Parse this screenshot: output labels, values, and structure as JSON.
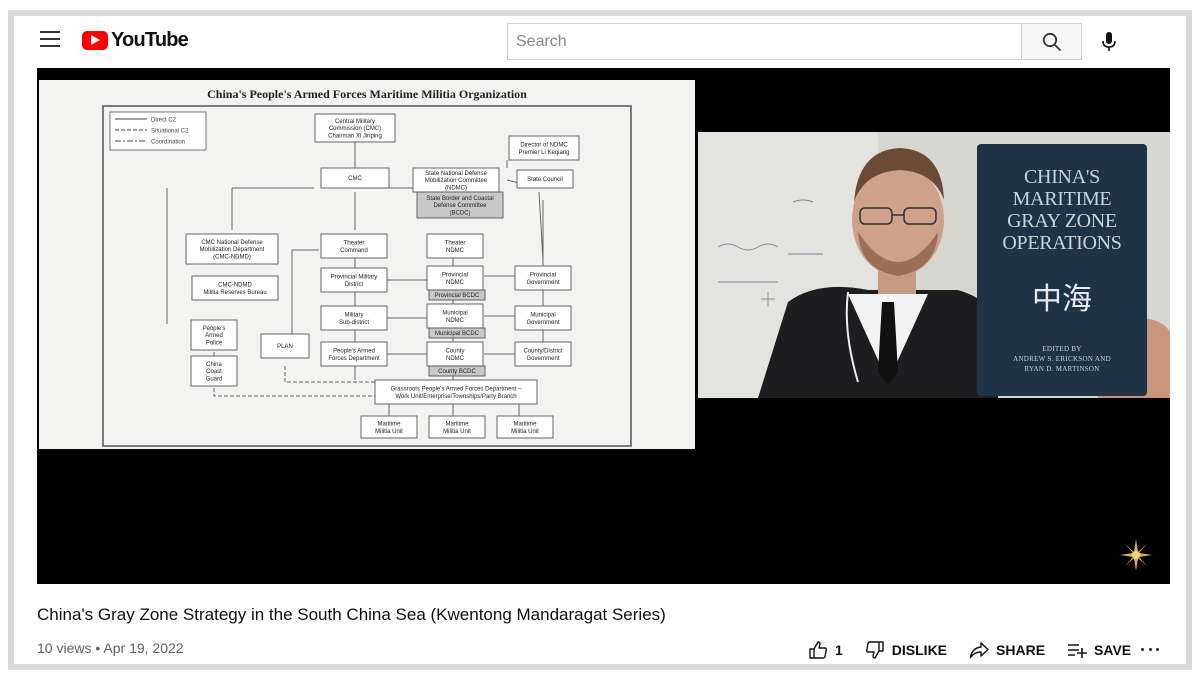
{
  "header": {
    "logo_text": "YouTube",
    "search": {
      "placeholder": "Search",
      "value": ""
    },
    "icons": [
      "menu-icon",
      "youtube-logo",
      "search-icon",
      "mic-icon"
    ]
  },
  "video": {
    "title": "China's Gray Zone Strategy in the South China Sea (Kwentong Mandaragat Series)",
    "views": "10 views",
    "separator": "•",
    "date": "Apr 19, 2022"
  },
  "slide": {
    "title": "China's People's Armed Forces Maritime Militia Organization",
    "legend": [
      "Direct C2",
      "Situational C2",
      "Coordination"
    ],
    "boxes": {
      "cmc_top": [
        "Central Military",
        "Commission (CMC)",
        "Chairman Xi Jinping"
      ],
      "ndmc_director": [
        "Director of NDMC",
        "Premier Li Keqiang"
      ],
      "cmc": [
        "CMC"
      ],
      "sndmc": [
        "State National Defense",
        "Mobilization Committee",
        "(NDMC)"
      ],
      "bcdc": [
        "State Border and Coastal",
        "Defense Committee",
        "(BCDC)"
      ],
      "state_council": [
        "State Council"
      ],
      "ndmd": [
        "CMC National Defense",
        "Mobilization Department",
        "(CMC-NDMD)"
      ],
      "theater_cmd": [
        "Theater",
        "Command"
      ],
      "theater_ndmc": [
        "Theater",
        "NDMC"
      ],
      "militia_bureau": [
        "CMC-NDMD",
        "Militia Reserves Bureau"
      ],
      "prov_district": [
        "Provincial Military",
        "District"
      ],
      "prov_ndmc": [
        "Provincial",
        "NDMC"
      ],
      "prov_gov": [
        "Provincial",
        "Government"
      ],
      "prov_bcdc": [
        "Provincial BCDC"
      ],
      "pap": [
        "People's",
        "Armed",
        "Police"
      ],
      "plan": [
        "PLAN"
      ],
      "mil_sub": [
        "Military",
        "Sub-district"
      ],
      "mun_ndmc": [
        "Municipal",
        "NDMC"
      ],
      "mun_gov": [
        "Municipal",
        "Government"
      ],
      "mun_bcdc": [
        "Municipal BCDC"
      ],
      "ccg": [
        "China",
        "Coast",
        "Guard"
      ],
      "pafd": [
        "People's Armed",
        "Forces Department"
      ],
      "county_ndmc": [
        "County",
        "NDMC"
      ],
      "county_gov": [
        "County/District",
        "Government"
      ],
      "county_bcdc": [
        "County BCDC"
      ],
      "grassroots": [
        "Grassroots People's Armed Forces Department –",
        "Work Unit/Enterprise/Townships/Party Branch"
      ],
      "unit1": [
        "Maritime",
        "Militia Unit"
      ],
      "unit2": [
        "Maritime",
        "Militia Unit"
      ],
      "unit3": [
        "Maritime",
        "Militia Unit"
      ]
    }
  },
  "book": {
    "title_lines": [
      "CHINA'S MARITIME",
      "GRAY ZONE",
      "OPERATIONS"
    ],
    "chinese": "中海",
    "editors": [
      "EDITED BY",
      "ANDREW S. ERICKSON AND",
      "RYAN D. MARTINSON"
    ]
  },
  "actions": {
    "like_count": "1",
    "dislike_label": "DISLIKE",
    "share_label": "SHARE",
    "save_label": "SAVE"
  },
  "colors": {
    "brand_red": "#ff0000",
    "player_bg": "#000000",
    "meta_text": "#606060"
  }
}
